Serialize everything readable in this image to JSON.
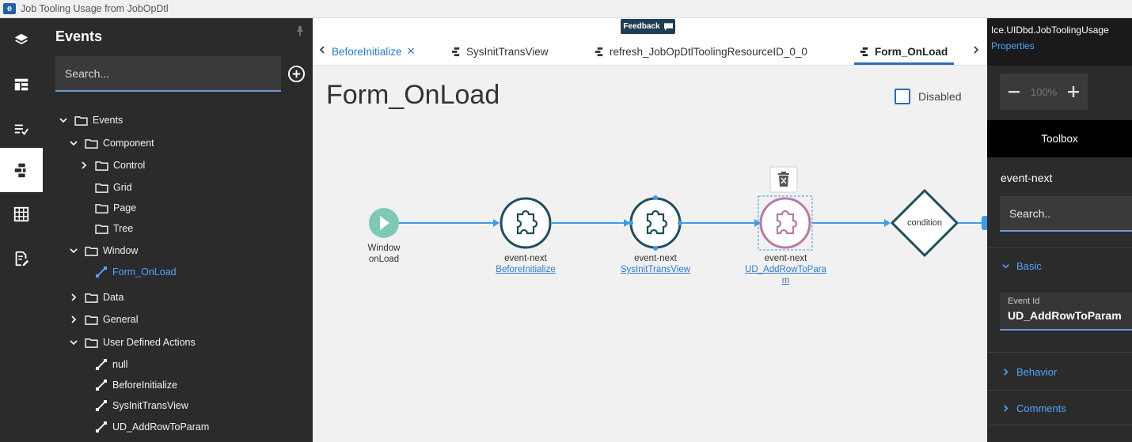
{
  "window": {
    "title": "Job Tooling Usage from JobOpDtl",
    "logo": "e"
  },
  "rail": {
    "items": [
      {
        "icon": "layers-icon",
        "active": false
      },
      {
        "icon": "layout-icon",
        "active": false
      },
      {
        "icon": "checklist-icon",
        "active": false
      },
      {
        "icon": "event-flow-icon",
        "active": true
      },
      {
        "icon": "grid-icon",
        "active": false
      },
      {
        "icon": "edit-doc-icon",
        "active": false
      }
    ]
  },
  "events_panel": {
    "title": "Events",
    "search_placeholder": "Search...",
    "tree": [
      {
        "label": "Events",
        "level": 0,
        "chev": "down",
        "icon": "folder"
      },
      {
        "label": "Component",
        "level": 1,
        "chev": "down",
        "icon": "folder"
      },
      {
        "label": "Control",
        "level": 2,
        "chev": "right",
        "icon": "folder"
      },
      {
        "label": "Grid",
        "level": 2,
        "chev": "none",
        "icon": "folder"
      },
      {
        "label": "Page",
        "level": 2,
        "chev": "none",
        "icon": "folder"
      },
      {
        "label": "Tree",
        "level": 2,
        "chev": "none",
        "icon": "folder"
      },
      {
        "label": "Window",
        "level": 1,
        "chev": "down",
        "icon": "folder"
      },
      {
        "label": "Form_OnLoad",
        "level": 2,
        "chev": "none",
        "icon": "link",
        "selected": true
      },
      {
        "label": "Data",
        "level": 1,
        "chev": "right",
        "icon": "folder"
      },
      {
        "label": "General",
        "level": 1,
        "chev": "right",
        "icon": "folder"
      },
      {
        "label": "User Defined Actions",
        "level": 1,
        "chev": "down",
        "icon": "folder"
      },
      {
        "label": "null",
        "level": 2,
        "chev": "none",
        "icon": "link"
      },
      {
        "label": "BeforeInitialize",
        "level": 2,
        "chev": "none",
        "icon": "link"
      },
      {
        "label": "SysInitTransView",
        "level": 2,
        "chev": "none",
        "icon": "link"
      },
      {
        "label": "UD_AddRowToParam",
        "level": 2,
        "chev": "none",
        "icon": "link"
      }
    ]
  },
  "editor": {
    "feedback_label": "Feedback",
    "tabs": [
      {
        "label": "BeforeInitialize",
        "style": "link",
        "closable": true,
        "icon": ""
      },
      {
        "label": "SysInitTransView",
        "style": "plain",
        "closable": false,
        "icon": "flow"
      },
      {
        "label": "refresh_JobOpDtlToolingResourceID_0_0",
        "style": "plain",
        "closable": false,
        "icon": "flow"
      },
      {
        "label": "Form_OnLoad",
        "style": "active",
        "closable": false,
        "icon": "flow"
      }
    ],
    "page_title": "Form_OnLoad",
    "disabled_label": "Disabled",
    "disabled_checked": false,
    "nodes": {
      "start": {
        "line1": "Window",
        "line2": "onLoad"
      },
      "n1": {
        "type": "event-next",
        "name": "BeforeInitialize"
      },
      "n2": {
        "type": "event-next",
        "name": "SysInitTransView"
      },
      "n3": {
        "type": "event-next",
        "name_line1": "UD_AddRowToParam",
        "name_line2": "m",
        "name_a": "UD_AddRowToPara"
      },
      "condition": {
        "label": "condition"
      }
    },
    "colors": {
      "accent": "#2d6db6",
      "node_ring": "#1f4e5f",
      "selected_ring": "#b87aa6",
      "start": "#7ec8b6",
      "connector": "#3d9be9"
    }
  },
  "properties": {
    "element_name": "Ice.UIDbd.JobToolingUsage",
    "properties_link": "Properties",
    "zoom": "100%",
    "toolbox_label": "Toolbox",
    "section_title": "event-next",
    "search_placeholder": "Search..",
    "sections": {
      "basic": "Basic",
      "behavior": "Behavior",
      "comments": "Comments"
    },
    "event_id_label": "Event Id",
    "event_id_value": "UD_AddRowToParam"
  }
}
